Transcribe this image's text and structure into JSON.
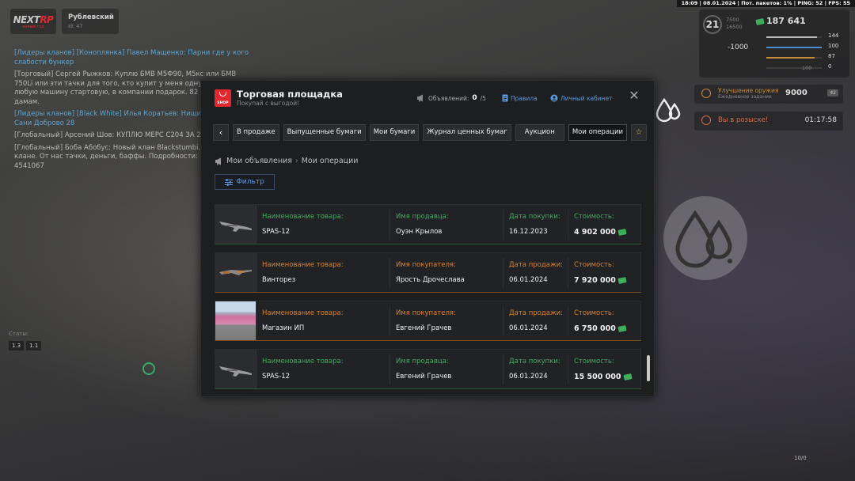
{
  "hud": {
    "logo_text": "NEXT",
    "logo_suffix": "RP",
    "logo_sub": "новый год",
    "server_name": "Рублевский",
    "server_num": "Id: 47",
    "topbar": "18:09 | 08.01.2024 | Пот. пакетов: 1% | PING: 52 | FPS: 55",
    "level": "21",
    "xp_current": "7500",
    "xp_total": "16500",
    "money": "187 641",
    "debt": "-1000",
    "health": "144",
    "armor": "100",
    "hunger": "87",
    "thirst": "0",
    "stamina": "100",
    "job_title": "Улучшение оружия",
    "job_sub": "Ежедневное задание",
    "job_amount": "9000",
    "job_badge": "42",
    "wanted_label": "Вы в розыске!",
    "wanted_timer": "01:17:58",
    "stat_label": "Статы:",
    "stat_box_1": "1.3",
    "stat_box_2": "1.1",
    "ammo": "10/0"
  },
  "chat": [
    {
      "text": "[Лидеры кланов] [Коноплянка] Павел Мащенко: Парни где у кого слабости бункер",
      "color": "blue"
    },
    {
      "text": "[Торговый] Сергей Рыжков: Куплю БМВ М5Ф90, М5кс или БМВ 750Li или эти тачки для того, кто купит у меня одну из них, или в любую машину стартовую, в компании подарок. 82 подарок дамам.",
      "color": "grey"
    },
    {
      "text": "[Лидеры кланов] [Black White] Илья Коратьев: Нищие задроты Сани Доброво 28",
      "color": "blue"
    },
    {
      "text": "[Глобальный] Арсений Шов: КУПЛЮ МЕРС С204 ЗА 2",
      "color": "grey"
    },
    {
      "text": "[Глобальный] Боба Абобус: Новый клан Blackstumbi, скидки в клане. От нас тачки, деньги, баффы. Подробности: Карли 4541067",
      "color": "grey"
    }
  ],
  "modal": {
    "title": "Торговая площадка",
    "subtitle": "Покупай с выгодой!",
    "shop_label": "SHOP",
    "ads_label": "Объявлений:",
    "ads_current": "0",
    "ads_max": "/5",
    "rules_label": "Правила",
    "cabinet_label": "Личный кабинет",
    "close_label": "✕",
    "tabs": [
      {
        "label": "В продаже"
      },
      {
        "label": "Выпущенные бумаги"
      },
      {
        "label": "Мои бумаги"
      },
      {
        "label": "Журнал ценных бумаг"
      },
      {
        "label": "Аукцион"
      },
      {
        "label": "Мои операции"
      }
    ],
    "breadcrumb_root": "Мои объявления",
    "breadcrumb_current": "Мои операции",
    "filter_label": "Фильтр",
    "operations": [
      {
        "type": "buy",
        "item_label": "Наименование товара:",
        "item": "SPAS-12",
        "party_label": "Имя продавца:",
        "party": "Оуэн Крылов",
        "date_label": "Дата покупки:",
        "date": "16.12.2023",
        "price_label": "Стоимость:",
        "price": "4 902 000",
        "thumb": "gun"
      },
      {
        "type": "sell",
        "item_label": "Наименование товара:",
        "item": "Винторез",
        "party_label": "Имя покупателя:",
        "party": "Ярость Дрочеслава",
        "date_label": "Дата продажи:",
        "date": "06.01.2024",
        "price_label": "Стоимость:",
        "price": "7 920 000",
        "thumb": "rifle"
      },
      {
        "type": "sell",
        "item_label": "Наименование товара:",
        "item": "Магазин ИП",
        "party_label": "Имя покупателя:",
        "party": "Евгений Грачев",
        "date_label": "Дата продажи:",
        "date": "06.01.2024",
        "price_label": "Стоимость:",
        "price": "6 750 000",
        "thumb": "shop"
      },
      {
        "type": "buy",
        "item_label": "Наименование товара:",
        "item": "SPAS-12",
        "party_label": "Имя продавца:",
        "party": "Евгений Грачев",
        "date_label": "Дата покупки:",
        "date": "06.01.2024",
        "price_label": "Стоимость:",
        "price": "15 500 000",
        "thumb": "gun"
      }
    ]
  },
  "colors": {
    "buy_label": "#3fae5a",
    "sell_label": "#d9822b",
    "accent_blue": "#5d9be0",
    "brand_red": "#e3282d"
  }
}
